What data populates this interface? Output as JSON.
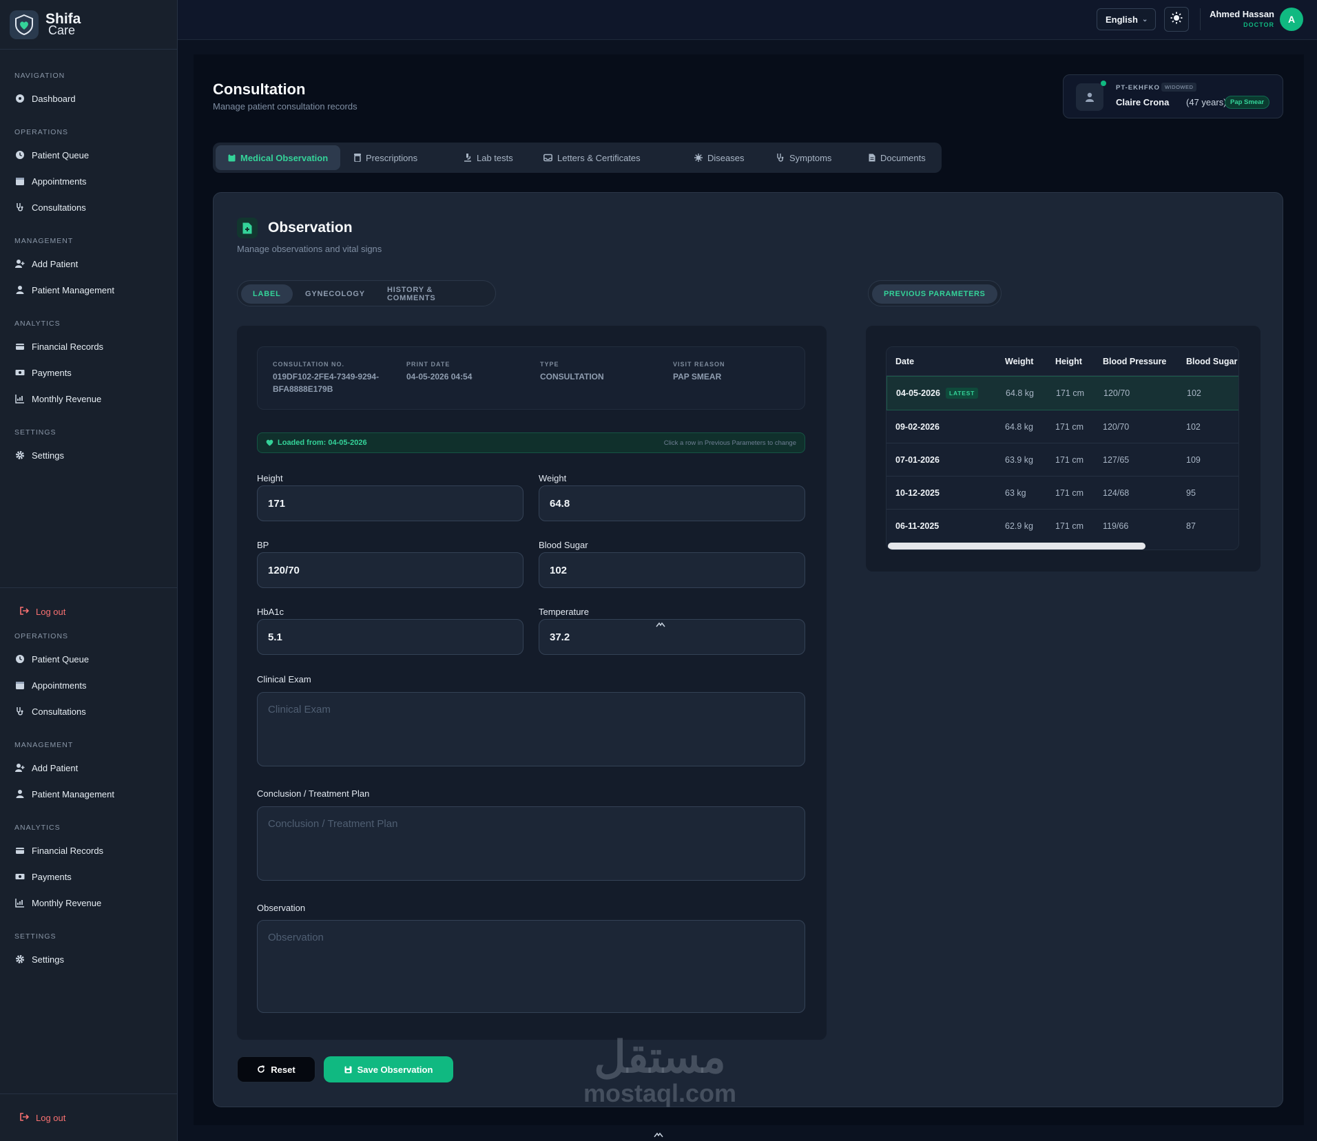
{
  "brand": {
    "line1": "Shifa",
    "line2": "Care"
  },
  "sidebar": {
    "group1": {
      "sections": [
        {
          "title": "NAVIGATION",
          "items": [
            {
              "label": "Dashboard",
              "icon": "dashboard-icon"
            }
          ]
        },
        {
          "title": "OPERATIONS",
          "items": [
            {
              "label": "Patient Queue",
              "icon": "clock-icon"
            },
            {
              "label": "Appointments",
              "icon": "calendar-icon"
            },
            {
              "label": "Consultations",
              "icon": "stethoscope-icon"
            }
          ]
        },
        {
          "title": "MANAGEMENT",
          "items": [
            {
              "label": "Add Patient",
              "icon": "user-plus-icon"
            },
            {
              "label": "Patient Management",
              "icon": "user-icon"
            }
          ]
        },
        {
          "title": "ANALYTICS",
          "items": [
            {
              "label": "Financial Records",
              "icon": "wallet-icon"
            },
            {
              "label": "Payments",
              "icon": "money-icon"
            },
            {
              "label": "Monthly Revenue",
              "icon": "chart-icon"
            }
          ]
        },
        {
          "title": "SETTINGS",
          "items": [
            {
              "label": "Settings",
              "icon": "gear-icon"
            }
          ]
        }
      ]
    },
    "logout_label": "Log out",
    "group2": {
      "sections": [
        {
          "title": "OPERATIONS",
          "items": [
            {
              "label": "Patient Queue"
            },
            {
              "label": "Appointments"
            },
            {
              "label": "Consultations"
            }
          ]
        },
        {
          "title": "MANAGEMENT",
          "items": [
            {
              "label": "Add Patient"
            },
            {
              "label": "Patient Management"
            }
          ]
        },
        {
          "title": "ANALYTICS",
          "items": [
            {
              "label": "Financial Records"
            },
            {
              "label": "Payments"
            },
            {
              "label": "Monthly Revenue"
            }
          ]
        },
        {
          "title": "SETTINGS",
          "items": [
            {
              "label": "Settings"
            }
          ]
        }
      ]
    }
  },
  "topbar": {
    "language": "English",
    "user_name": "Ahmed Hassan",
    "user_role": "DOCTOR",
    "avatar_letter": "A"
  },
  "page": {
    "title": "Consultation",
    "subtitle": "Manage patient consultation records"
  },
  "patient": {
    "id": "PT-EKHFKO",
    "status": "WIDOWED",
    "name": "Claire Crona",
    "age": "(47 years)",
    "reason": "Pap Smear"
  },
  "tabs": [
    "Medical Observation",
    "Prescriptions",
    "Lab tests",
    "Letters & Certificates",
    "Diseases",
    "Symptoms",
    "Documents"
  ],
  "observation": {
    "title": "Observation",
    "subtitle": "Manage observations and vital signs",
    "subtabs": [
      "LABEL",
      "GYNECOLOGY",
      "HISTORY & COMMENTS"
    ],
    "previous_button": "PREVIOUS PARAMETERS",
    "info": {
      "consultation_no_label": "CONSULTATION NO.",
      "consultation_no_line1": "019DF102-2FE4-7349-9294-",
      "consultation_no_line2": "BFA8888E179B",
      "print_date_label": "PRINT DATE",
      "print_date": "04-05-2026 04:54",
      "type_label": "TYPE",
      "type": "CONSULTATION",
      "visit_reason_label": "VISIT REASON",
      "visit_reason": "PAP SMEAR"
    },
    "loaded_from": "Loaded from: 04-05-2026",
    "loaded_hint": "Click a row in Previous Parameters to change",
    "fields": {
      "height_label": "Height",
      "height": "171",
      "weight_label": "Weight",
      "weight": "64.8",
      "bp_label": "BP",
      "bp": "120/70",
      "sugar_label": "Blood Sugar",
      "sugar": "102",
      "hba1c_label": "HbA1c",
      "hba1c": "5.1",
      "temp_label": "Temperature",
      "temp": "37.2"
    },
    "clinical_exam_label": "Clinical Exam",
    "clinical_exam_placeholder": "Clinical Exam",
    "conclusion_label": "Conclusion / Treatment Plan",
    "conclusion_placeholder": "Conclusion / Treatment Plan",
    "observation_label": "Observation",
    "observation_placeholder": "Observation",
    "reset_label": "Reset",
    "save_label": "Save Observation"
  },
  "previous_params": {
    "columns": [
      "Date",
      "Weight",
      "Height",
      "Blood Pressure",
      "Blood Sugar"
    ],
    "latest_badge": "LATEST",
    "rows": [
      [
        "04-05-2026",
        "64.8 kg",
        "171 cm",
        "120/70",
        "102"
      ],
      [
        "09-02-2026",
        "64.8 kg",
        "171 cm",
        "120/70",
        "102"
      ],
      [
        "07-01-2026",
        "63.9 kg",
        "171 cm",
        "127/65",
        "109"
      ],
      [
        "10-12-2025",
        "63 kg",
        "171 cm",
        "124/68",
        "95"
      ],
      [
        "06-11-2025",
        "62.9 kg",
        "171 cm",
        "119/66",
        "87"
      ]
    ]
  },
  "watermark": {
    "arabic": "مستقل",
    "latin": "mostaql.com"
  },
  "colors": {
    "accent": "#10b981",
    "danger": "#f87171",
    "background": "#0b1220"
  }
}
